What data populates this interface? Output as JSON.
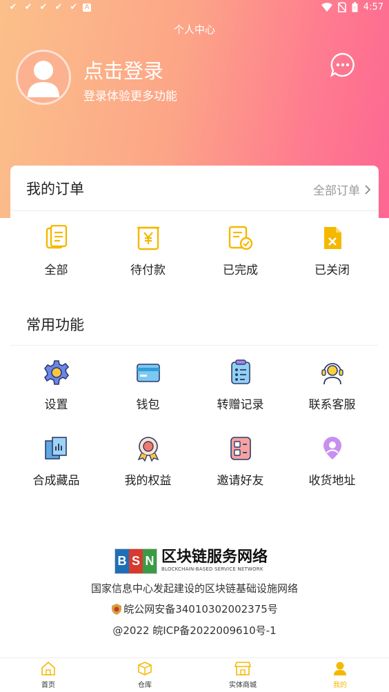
{
  "status_bar": {
    "time": "4:57"
  },
  "header": {
    "title": "个人中心",
    "login_title": "点击登录",
    "login_subtitle": "登录体验更多功能"
  },
  "orders": {
    "title": "我的订单",
    "all_label": "全部订单",
    "items": [
      {
        "label": "全部",
        "icon": "document-icon"
      },
      {
        "label": "待付款",
        "icon": "yen-receipt-icon"
      },
      {
        "label": "已完成",
        "icon": "completed-doc-icon"
      },
      {
        "label": "已关闭",
        "icon": "closed-doc-icon"
      }
    ]
  },
  "functions": {
    "title": "常用功能",
    "items": [
      {
        "label": "设置",
        "icon": "gear-icon"
      },
      {
        "label": "钱包",
        "icon": "wallet-icon"
      },
      {
        "label": "转赠记录",
        "icon": "record-list-icon"
      },
      {
        "label": "联系客服",
        "icon": "customer-service-icon"
      },
      {
        "label": "合成藏品",
        "icon": "collection-icon"
      },
      {
        "label": "我的权益",
        "icon": "medal-icon"
      },
      {
        "label": "邀请好友",
        "icon": "invite-icon"
      },
      {
        "label": "收货地址",
        "icon": "location-icon"
      }
    ]
  },
  "footer": {
    "bsn_letters": [
      "B",
      "S",
      "N"
    ],
    "bsn_name": "区块链服务网络",
    "bsn_english": "BLOCKCHAIN-BASED SERVICE NETWORK",
    "tagline": "国家信息中心发起建设的区块链基础设施网络",
    "police_record": "皖公网安备34010302002375号",
    "icp_record": "@2022 皖ICP备2022009610号-1"
  },
  "tabbar": {
    "items": [
      {
        "label": "首页",
        "icon": "home-icon"
      },
      {
        "label": "仓库",
        "icon": "box-icon"
      },
      {
        "label": "实体商城",
        "icon": "store-icon"
      },
      {
        "label": "我的",
        "icon": "profile-icon",
        "active": true
      }
    ]
  },
  "colors": {
    "accent": "#f5b800",
    "gradient_start": "#fbc08a",
    "gradient_end": "#fd6692",
    "bsn_blue": "#1f6fb8",
    "bsn_red": "#d63a2f",
    "bsn_green": "#3a9b46"
  }
}
